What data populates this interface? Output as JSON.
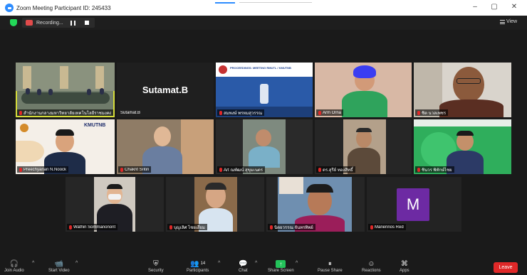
{
  "window": {
    "title": "Zoom Meeting Participant ID: 245433",
    "controls": [
      "–",
      "▢",
      "✕"
    ]
  },
  "top": {
    "recording_label": "Recording...",
    "view_label": "View"
  },
  "screen_slide": {
    "header_text": "PROCEEDINGS: MEETING RMUTL / KMUTNB"
  },
  "participants": [
    {
      "name": "สำนักงานกลางมหาวิทยาลัยเทคโนโลยีราชมงคล RMUTL",
      "muted": true
    },
    {
      "name": "Sutamat.B",
      "muted": false,
      "tile_text": "Sutamat.B"
    },
    {
      "name": "สมพงษ์ พรหมสุวรรณ",
      "muted": true
    },
    {
      "name": "Arm Orna",
      "muted": true
    },
    {
      "name": "ชิต นวลเพชร",
      "muted": true
    },
    {
      "name": "Preechyanan N.Noock",
      "muted": true
    },
    {
      "name": "Chakrit Sritiri",
      "muted": true
    },
    {
      "name": "Art ณพัฒน์ สุขุมเนตร",
      "muted": true
    },
    {
      "name": "ดร.สุรีย์ ทองสิทธิ์",
      "muted": true
    },
    {
      "name": "ชินวร พิทักษ์ไชย",
      "muted": true
    },
    {
      "name": "Wathin Sommanonont",
      "muted": true
    },
    {
      "name": "บุญเลิศ ไชยเสี่ยม",
      "muted": true
    },
    {
      "name": "นิตยวรรณ จันทรทิพย์",
      "muted": true
    },
    {
      "name": "Manennos Red",
      "muted": true,
      "avatar_letter": "M"
    }
  ],
  "toolbar": {
    "join_audio": "Join Audio",
    "start_video": "Start Video",
    "security": "Security",
    "participants": "Participants",
    "participant_count": "14",
    "chat": "Chat",
    "share_screen": "Share Screen",
    "pause_share": "Pause Share",
    "reactions": "Reactions",
    "apps": "Apps",
    "leave": "Leave"
  },
  "colors": {
    "active_speaker_border": "#d6dd3a",
    "leave_button": "#e02828",
    "share_button": "#23c25a",
    "avatar_bg": "#6d2aa3",
    "mic_muted": "#e02828"
  }
}
